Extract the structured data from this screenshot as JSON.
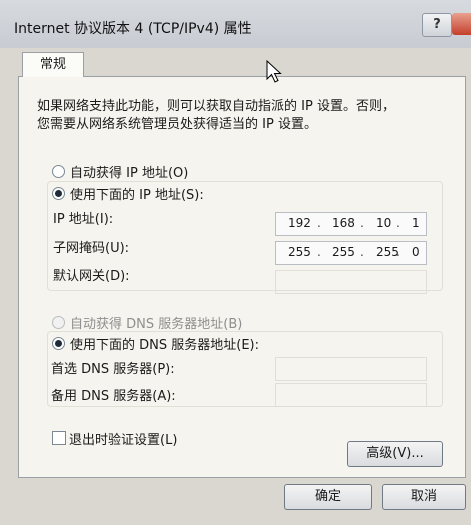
{
  "window": {
    "title": "Internet 协议版本 4 (TCP/IPv4) 属性",
    "help_label": "?"
  },
  "tab": {
    "label": "常规"
  },
  "description": {
    "line1": "如果网络支持此功能，则可以获取自动指派的 IP 设置。否则，",
    "line2": "您需要从网络系统管理员处获得适当的 IP 设置。"
  },
  "ip": {
    "auto_label": "自动获得 IP 地址(O)",
    "manual_label": "使用下面的 IP 地址(S):",
    "mode": "manual",
    "address_label": "IP 地址(I):",
    "address": [
      "192",
      "168",
      "10",
      "1"
    ],
    "subnet_label": "子网掩码(U):",
    "subnet": [
      "255",
      "255",
      "255",
      "0"
    ],
    "gateway_label": "默认网关(D):"
  },
  "dns": {
    "auto_label": "自动获得 DNS 服务器地址(B)",
    "manual_label": "使用下面的 DNS 服务器地址(E):",
    "mode": "manual",
    "preferred_label": "首选 DNS 服务器(P):",
    "alternate_label": "备用 DNS 服务器(A):"
  },
  "validate_label": "退出时验证设置(L)",
  "advanced_label": "高级(V)...",
  "ok_label": "确定",
  "cancel_label": "取消",
  "icons": {
    "cursor": "mouse-pointer-icon",
    "close": "close-icon",
    "help": "help-icon"
  }
}
